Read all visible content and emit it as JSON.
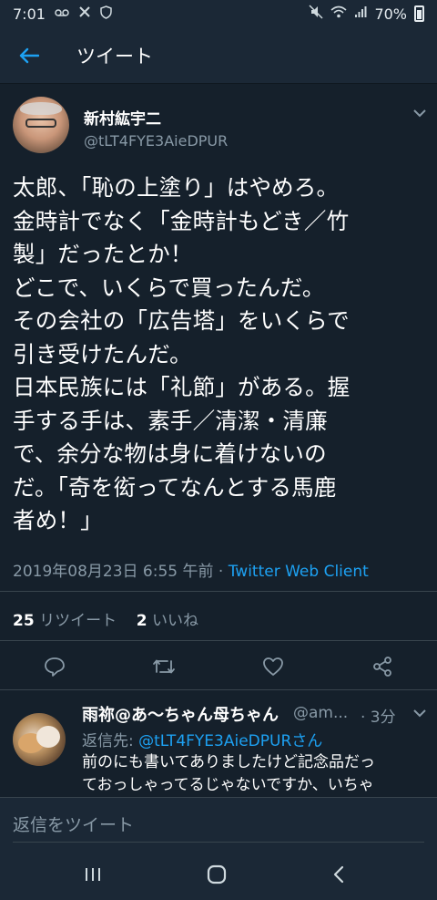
{
  "status_bar": {
    "time": "7:01",
    "battery": "70%",
    "icons": [
      "voicemail-icon",
      "tools-icon",
      "shield-icon",
      "mute-icon",
      "wifi-icon",
      "signal-icon",
      "battery-icon"
    ]
  },
  "header": {
    "title": "ツイート"
  },
  "tweet": {
    "user_name": "新村紘宇二",
    "user_handle": "@tLT4FYE3AieDPUR",
    "lines": [
      "太郎、「恥の上塗り」はやめろ。",
      "金時計でなく「金時計もどき／竹",
      "製」だったとか！",
      "どこで、いくらで買ったんだ。",
      "その会社の「広告塔」をいくらで",
      "引き受けたんだ。",
      "日本民族には「礼節」がある。握",
      "手する手は、素手／清潔・清廉",
      "で、余分な物は身に着けないの",
      "だ。「奇を衒ってなんとする馬鹿",
      "者め！」"
    ],
    "timestamp": "2019年08月23日 6:55 午前",
    "separator": " · ",
    "client": "Twitter Web Client",
    "retweet_count": "25",
    "retweet_label": "リツイート",
    "like_count": "2",
    "like_label": "いいね"
  },
  "reply": {
    "name": "雨祢@あ～ちゃん母ちゃん",
    "handle": "@am...",
    "time": "· 3分",
    "replying_to_prefix": "返信先: ",
    "replying_to": "@tLT4FYE3AieDPURさん",
    "text_lines": [
      "前のにも書いてありましたけど記念品だっ",
      "ておっしゃってるじゃないですか、いちゃ"
    ]
  },
  "compose": {
    "placeholder": "返信をツイート"
  },
  "colors": {
    "background": "#15202b",
    "bar": "#1b2836",
    "accent": "#1da1f2",
    "secondary_text": "#8899a6",
    "divider": "#38444d"
  }
}
